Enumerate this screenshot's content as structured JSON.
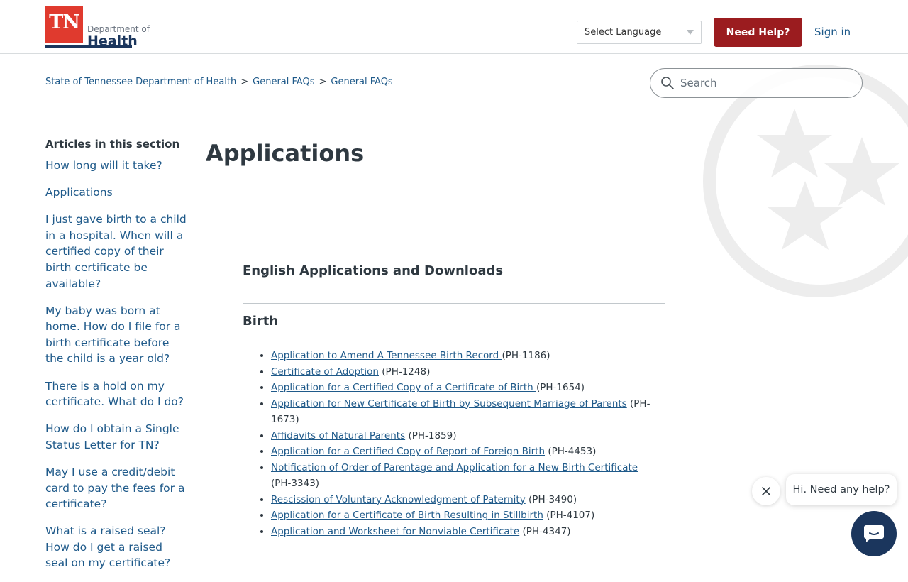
{
  "header": {
    "logo": {
      "mark": "TN",
      "line1": "Department of",
      "line2": "Health"
    },
    "language_select": "Select Language",
    "help_button": "Need Help?",
    "sign_in": "Sign in"
  },
  "breadcrumb": [
    "State of Tennessee Department of Health",
    "General FAQs",
    "General FAQs"
  ],
  "breadcrumb_separator": ">",
  "search": {
    "placeholder": "Search"
  },
  "sidebar": {
    "title": "Articles in this section",
    "items": [
      "How long will it take?",
      "Applications",
      "I just gave birth to a child in a hospital. When will a certified copy of their birth certificate be available?",
      "My baby was born at home. How do I file for a birth certificate before the child is a year old?",
      "There is a hold on my certificate. What do I do?",
      "How do I obtain a Single Status Letter for TN?",
      "May I use a credit/debit card to pay the fees for a certificate?",
      "What is a raised seal? How do I get a raised seal on my certificate?"
    ]
  },
  "article": {
    "title": "Applications",
    "section_heading": "English Applications and Downloads",
    "subheading": "Birth",
    "applications": [
      {
        "link": "Application to Amend A Tennessee Birth Record ",
        "code": "(PH-1186)"
      },
      {
        "link": "Certificate of Adoption",
        "code": "(PH-1248)"
      },
      {
        "link": "Application for a Certified Copy of a Certificate of Birth ",
        "code": "(PH-1654)"
      },
      {
        "link": "Application for New Certificate of Birth by Subsequent Marriage of Parents",
        "code": "(PH-1673)"
      },
      {
        "link": "Affidavits of Natural Parents",
        "code": "(PH-1859)"
      },
      {
        "link": "Application for a Certified Copy of Report of Foreign Birth",
        "code": "(PH-4453)"
      },
      {
        "link": "Notification of Order of Parentage and Application for a New Birth Certificate",
        "code": "(PH-3343)"
      },
      {
        "link": "Rescission of Voluntary Acknowledgment of Paternity",
        "code": "(PH-3490)"
      },
      {
        "link": "Application for a Certificate of Birth Resulting in Stillbirth",
        "code": "(PH-4107)"
      },
      {
        "link": "Application and Worksheet for Nonviable Certificate",
        "code": "(PH-4347)"
      }
    ]
  },
  "chat": {
    "greeting": "Hi. Need any help?"
  },
  "colors": {
    "brand_red": "#9b1c1f",
    "logo_red": "#e03a2e",
    "navy": "#1b365d",
    "link": "#1f5a8a"
  },
  "icons": [
    "search-icon",
    "caret-down-icon",
    "close-icon",
    "chat-icon",
    "tri-star-watermark"
  ]
}
